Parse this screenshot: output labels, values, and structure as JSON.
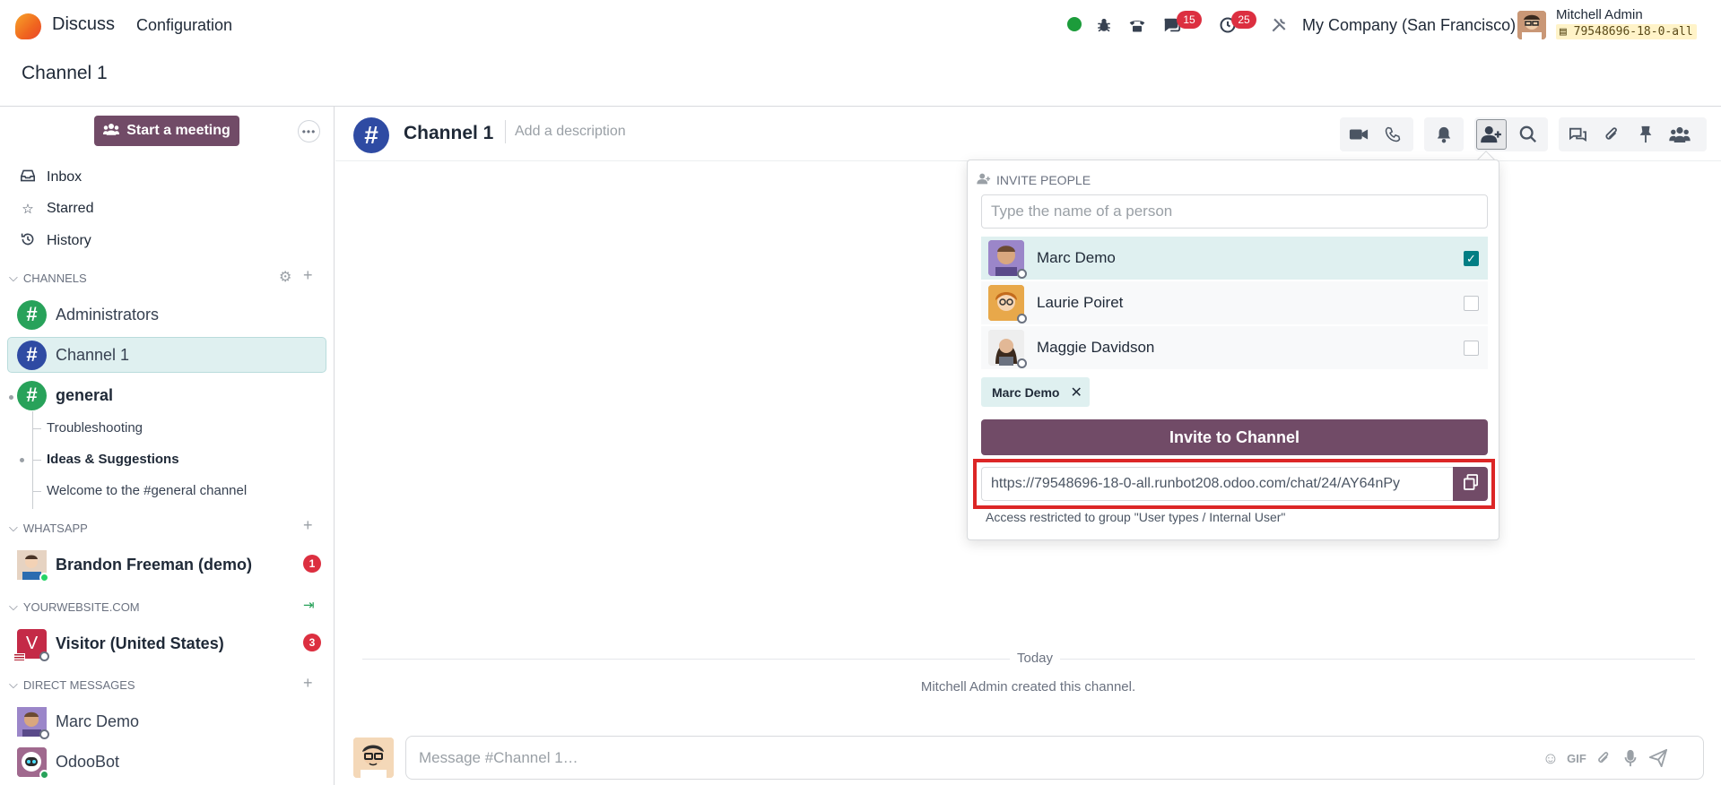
{
  "navbar": {
    "app_name": "Discuss",
    "menu_configuration": "Configuration",
    "messages_count": "15",
    "activities_count": "25",
    "company": "My Company (San Francisco)",
    "user_name": "Mitchell Admin",
    "db_name": "79548696-18-0-all"
  },
  "breadcrumb": "Channel 1",
  "sidebar": {
    "start_meeting": "Start a meeting",
    "mailboxes": [
      {
        "label": "Inbox",
        "icon": "inbox-icon"
      },
      {
        "label": "Starred",
        "icon": "star-icon"
      },
      {
        "label": "History",
        "icon": "history-icon"
      }
    ],
    "channels_header": "Channels",
    "channels": [
      {
        "label": "Administrators",
        "color": "#28a25a"
      },
      {
        "label": "Channel 1",
        "color": "#2f4ba3"
      },
      {
        "label": "general",
        "color": "#28a25a"
      }
    ],
    "sub_channels": [
      "Troubleshooting",
      "Ideas & Suggestions",
      "Welcome to the #general channel"
    ],
    "whatsapp_header": "WhatsApp",
    "whatsapp_contact": "Brandon Freeman (demo)",
    "whatsapp_unread": "1",
    "website_header": "yourwebsite.com",
    "visitor": "Visitor (United States)",
    "visitor_initial": "V",
    "visitor_unread": "3",
    "dm_header": "Direct messages",
    "direct_messages": [
      "Marc Demo",
      "OdooBot"
    ]
  },
  "thread": {
    "title": "Channel 1",
    "description_placeholder": "Add a description",
    "today": "Today",
    "created_note": "Mitchell Admin created this channel.",
    "composer_placeholder": "Message #Channel 1…",
    "gif_label": "GIF"
  },
  "invite": {
    "title": "Invite People",
    "search_placeholder": "Type the name of a person",
    "people": [
      {
        "name": "Marc Demo",
        "selected": true
      },
      {
        "name": "Laurie Poiret",
        "selected": false
      },
      {
        "name": "Maggie Davidson",
        "selected": false
      }
    ],
    "chip": "Marc Demo",
    "invite_button": "Invite to Channel",
    "link": "https://79548696-18-0-all.runbot208.odoo.com/chat/24/AY64nPy",
    "access_note": "Access restricted to group \"User types / Internal User\""
  },
  "colors": {
    "brand": "#714b67",
    "accent_teal": "#017e84",
    "badge_red": "#dc2f40",
    "highlight": "#dc2626"
  }
}
